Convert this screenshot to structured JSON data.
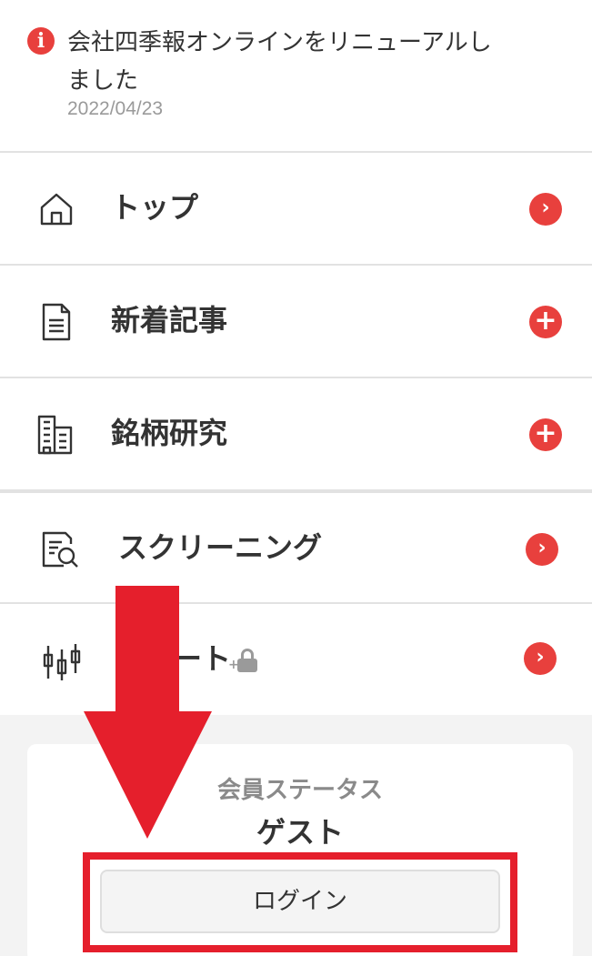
{
  "news": {
    "icon": "i",
    "title": "会社四季報オンラインをリニューアルしました",
    "date": "2022/04/23"
  },
  "menu": {
    "items": [
      {
        "label": "トップ",
        "icon": "home-icon",
        "action": "chevron",
        "action_glyph": "›"
      },
      {
        "label": "新着記事",
        "icon": "document-icon",
        "action": "plus",
        "action_glyph": "+"
      },
      {
        "label": "銘柄研究",
        "icon": "buildings-icon",
        "action": "plus",
        "action_glyph": "+"
      },
      {
        "label": "スクリーニング",
        "icon": "document-search-icon",
        "action": "chevron",
        "action_glyph": "›"
      },
      {
        "label": "ート",
        "icon": "candlestick-chart-icon",
        "action": "chevron",
        "action_glyph": "›",
        "locked": true
      }
    ]
  },
  "member": {
    "label": "会員ステータス",
    "status": "ゲスト",
    "login_label": "ログイン"
  },
  "colors": {
    "accent": "#e8403d",
    "annotation": "#e51f2c",
    "divider": "#e2e2e2",
    "muted": "#9a9a9a"
  }
}
